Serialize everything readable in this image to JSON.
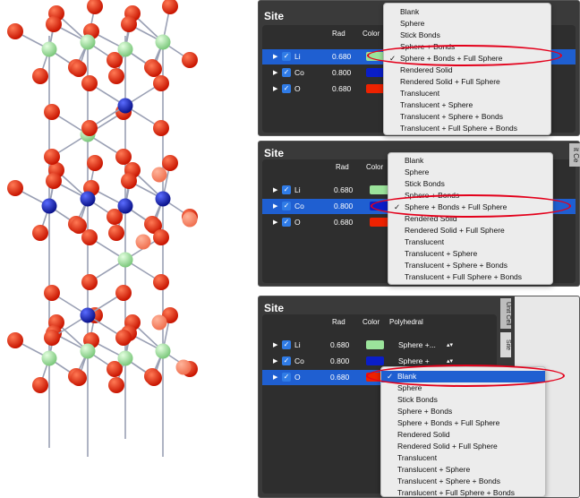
{
  "panel_title": "Site",
  "columns": {
    "rad": "Rad",
    "color": "Color",
    "polyhedral": "Polyhedral"
  },
  "atoms": [
    {
      "name": "Li",
      "rad": "0.680",
      "color": "#9be39b"
    },
    {
      "name": "Co",
      "rad": "0.800",
      "color": "#0a1ec8"
    },
    {
      "name": "O",
      "rad": "0.680",
      "color": "#ee2200"
    }
  ],
  "check_glyph": "✓",
  "expand_glyph": "▶",
  "menu_items": [
    "Blank",
    "Sphere",
    "Stick Bonds",
    "Sphere + Bonds",
    "Sphere + Bonds + Full Sphere",
    "Rendered Solid",
    "Rendered Solid + Full Sphere",
    "Translucent",
    "Translucent + Sphere",
    "Translucent + Sphere + Bonds",
    "Translucent + Full Sphere + Bonds"
  ],
  "panel3_polyhedral": [
    "Sphere +...",
    "Sphere +"
  ],
  "stepper_glyph": "▴▾",
  "side_tabs": [
    "Unit Cell",
    "Site"
  ],
  "side_tab_short": "it Ce",
  "accent_colors": {
    "oval": "#e3001b",
    "selection": "#1f5fd1",
    "li": "#9be39b",
    "co": "#0a1ec8",
    "o": "#ee2200"
  }
}
